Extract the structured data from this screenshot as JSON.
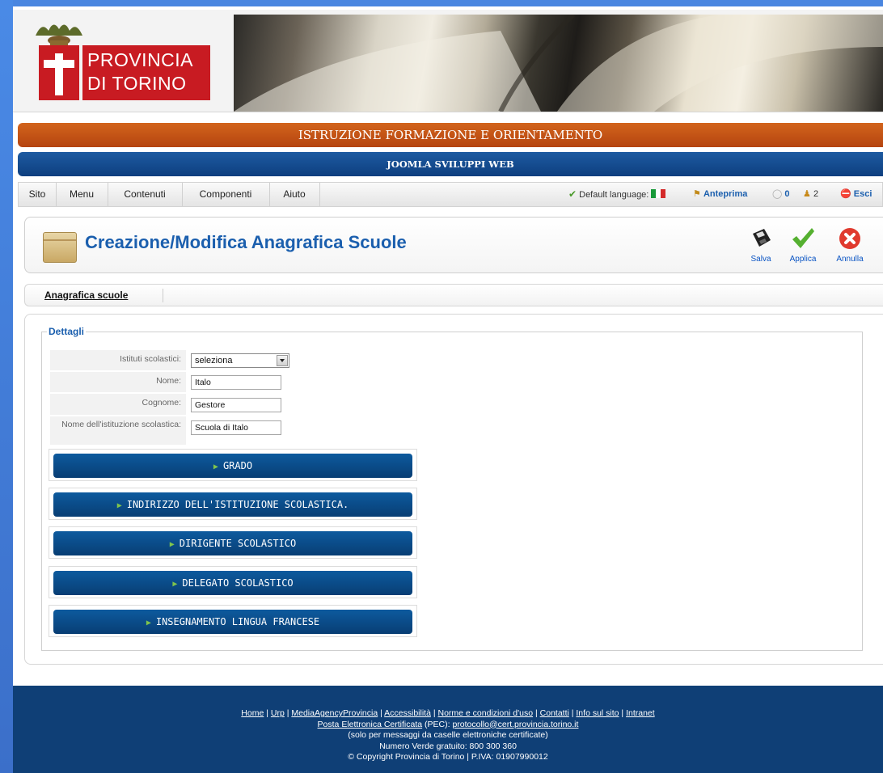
{
  "header": {
    "logo_text_line1": "PROVINCIA",
    "logo_text_line2": "DI TORINO"
  },
  "bars": {
    "orange_title": "ISTRUZIONE FORMAZIONE E ORIENTAMENTO",
    "blue_title": "JOOMLA SVILUPPI WEB"
  },
  "menu": {
    "items": [
      "Sito",
      "Menu",
      "Contenuti",
      "Componenti",
      "Aiuto"
    ],
    "default_language_label": "Default language:",
    "preview_label": "Anteprima",
    "messages_count": "0",
    "users_count": "2",
    "logout_label": "Esci"
  },
  "toolbar": {
    "title": "Creazione/Modifica Anagrafica Scuole",
    "save_label": "Salva",
    "apply_label": "Applica",
    "cancel_label": "Annulla"
  },
  "submenu": {
    "tab_label": "Anagrafica scuole"
  },
  "form": {
    "legend": "Dettagli",
    "fields": {
      "istituti_label": "Istituti scolastici:",
      "istituti_value": "seleziona",
      "nome_label": "Nome:",
      "nome_value": "Italo",
      "cognome_label": "Cognome:",
      "cognome_value": "Gestore",
      "istituzione_label": "Nome dell'istituzione scolastica:",
      "istituzione_value": "Scuola di Italo"
    },
    "sections": [
      "GRADO",
      "INDIRIZZO DELL'ISTITUZIONE SCOLASTICA.",
      "DIRIGENTE SCOLASTICO",
      "DELEGATO SCOLASTICO",
      "INSEGNAMENTO LINGUA FRANCESE"
    ]
  },
  "footer": {
    "links": [
      "Home",
      "Urp",
      "MediaAgencyProvincia",
      "Accessibilità",
      "Norme e condizioni d'uso",
      "Contatti",
      "Info sul sito",
      "Intranet"
    ],
    "pec_link": "Posta Elettronica Certificata",
    "pec_text": "(PEC):",
    "pec_email": "protocollo@cert.provincia.torino.it",
    "line3": "(solo per messaggi da caselle elettroniche certificate)",
    "line4": "Numero Verde gratuito: 800 300 360",
    "line5": "© Copyright Provincia di Torino | P.IVA: 01907990012"
  },
  "colors": {
    "orange_bar": "#c8561a",
    "blue_bar": "#134b8e",
    "title_blue": "#1b5fae",
    "footer_bg": "#0f3f76"
  }
}
